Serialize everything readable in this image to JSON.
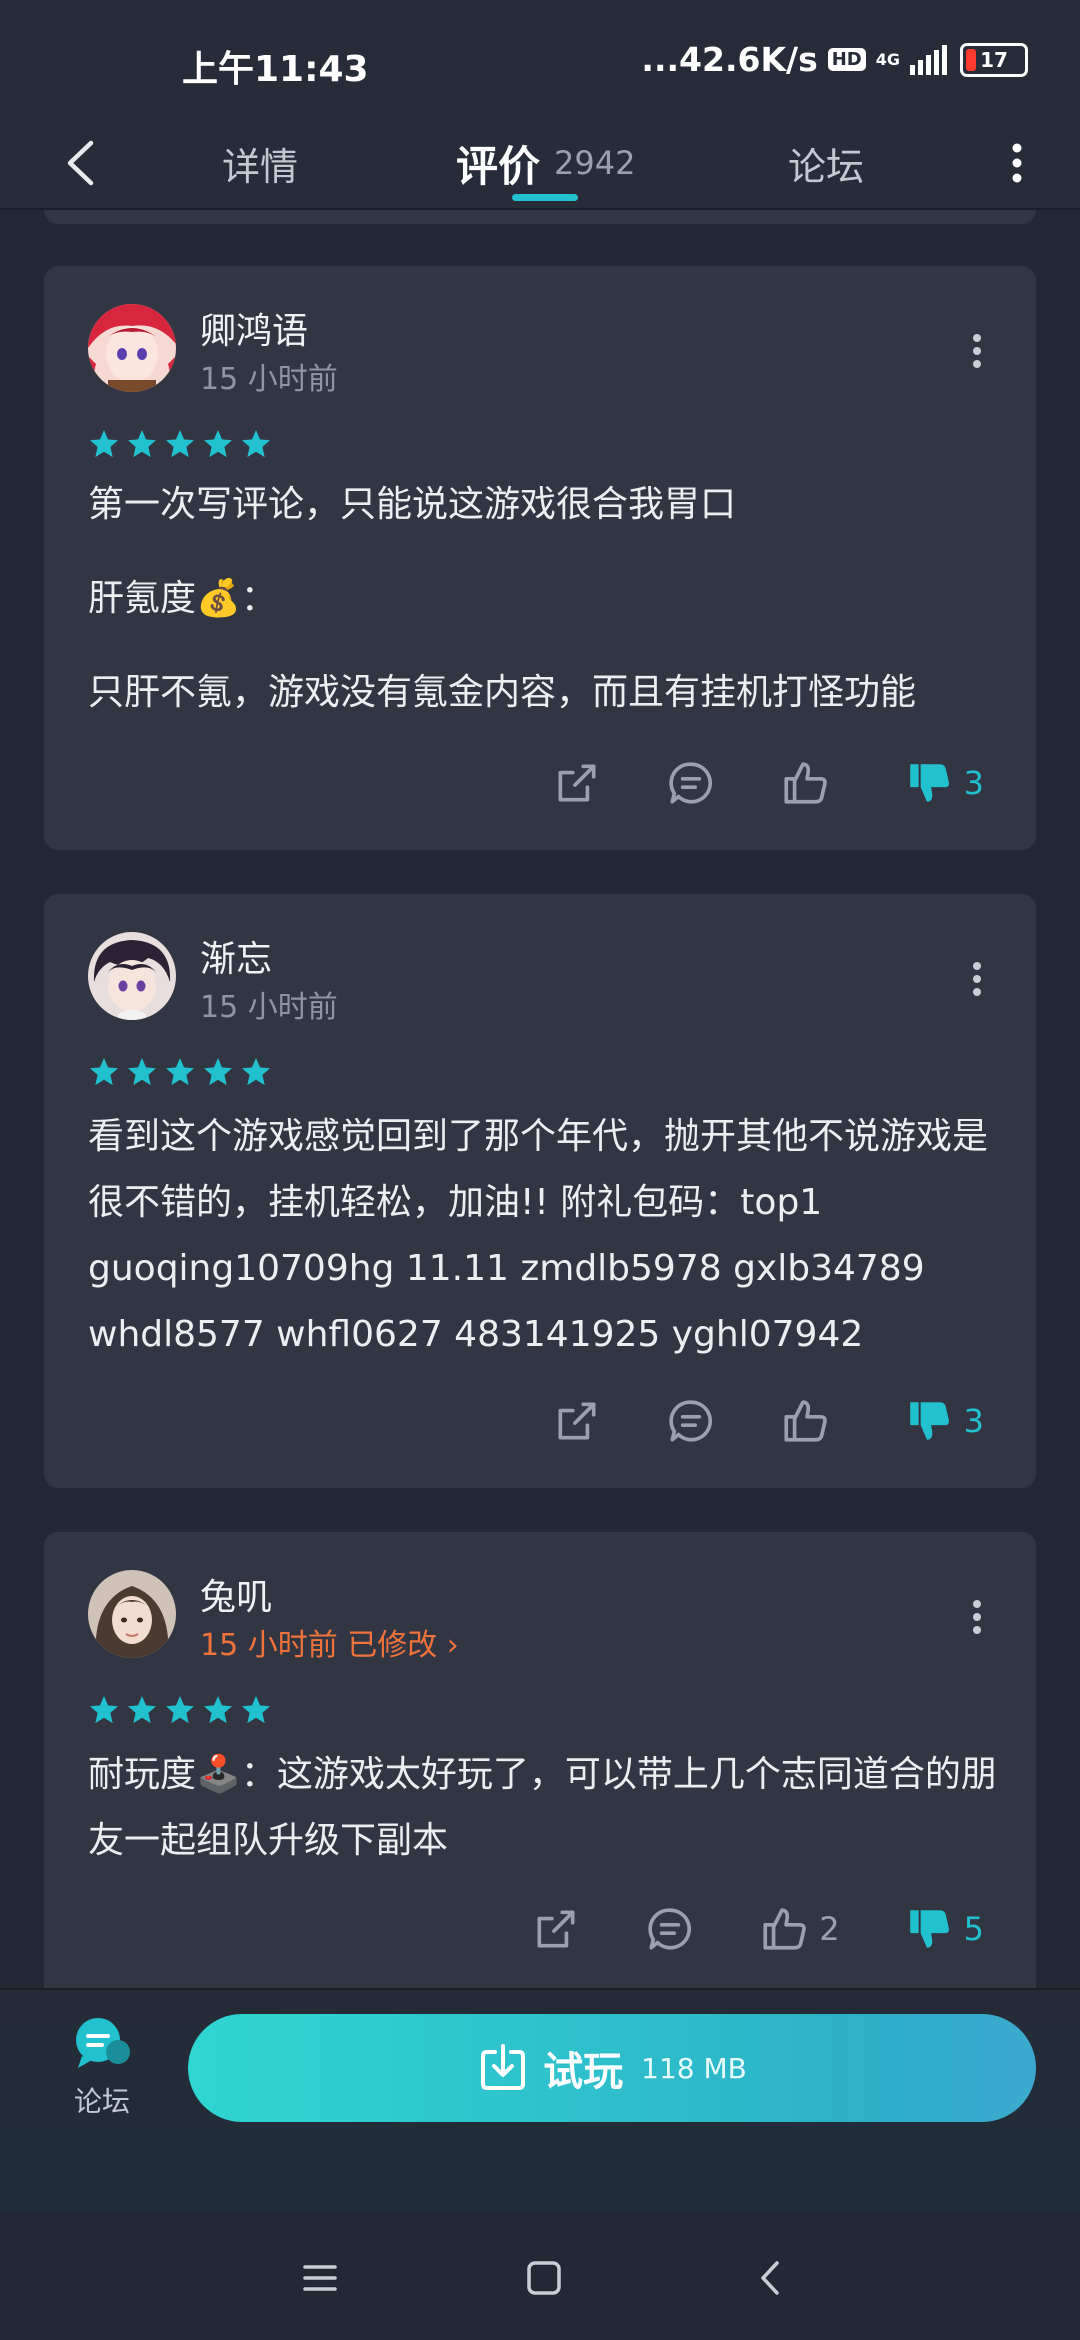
{
  "status": {
    "time": "上午11:43",
    "network_speed": "...42.6K/s",
    "hd": "HD",
    "network_type": "4G",
    "battery": "17"
  },
  "header": {
    "tabs": {
      "detail": "详情",
      "review": "评价",
      "review_count": "2942",
      "forum": "论坛"
    }
  },
  "reviews": [
    {
      "user": "卿鸿语",
      "time": "15 小时前",
      "stars": 5,
      "paragraphs": [
        "第一次写评论，只能说这游戏很合我胃口",
        "肝氪度💰：",
        "只肝不氪，游戏没有氪金内容，而且有挂机打怪功能"
      ],
      "like_count": "",
      "dislike_count": "3"
    },
    {
      "user": "渐忘",
      "time": "15 小时前",
      "stars": 5,
      "text": "看到这个游戏感觉回到了那个年代，抛开其他不说游戏是很不错的，挂机轻松，加油!! 附礼包码：top1 guoqing10709hg 11.11 zmdlb5978 gxlb34789 whdl8577 whfl0627 483141925 yghl07942",
      "like_count": "",
      "dislike_count": "3"
    },
    {
      "user": "兔叽",
      "time": "15 小时前 已修改 ›",
      "stars": 5,
      "text": "耐玩度🕹️：这游戏太好玩了，可以带上几个志同道合的朋友一起组队升级下副本",
      "like_count": "2",
      "dislike_count": "5"
    }
  ],
  "bottom": {
    "forum_label": "论坛",
    "trial_label": "试玩",
    "trial_size": "118 MB"
  },
  "colors": {
    "accent": "#22c1cf",
    "edited": "#f0733c",
    "card": "#313642",
    "background": "#232834"
  }
}
